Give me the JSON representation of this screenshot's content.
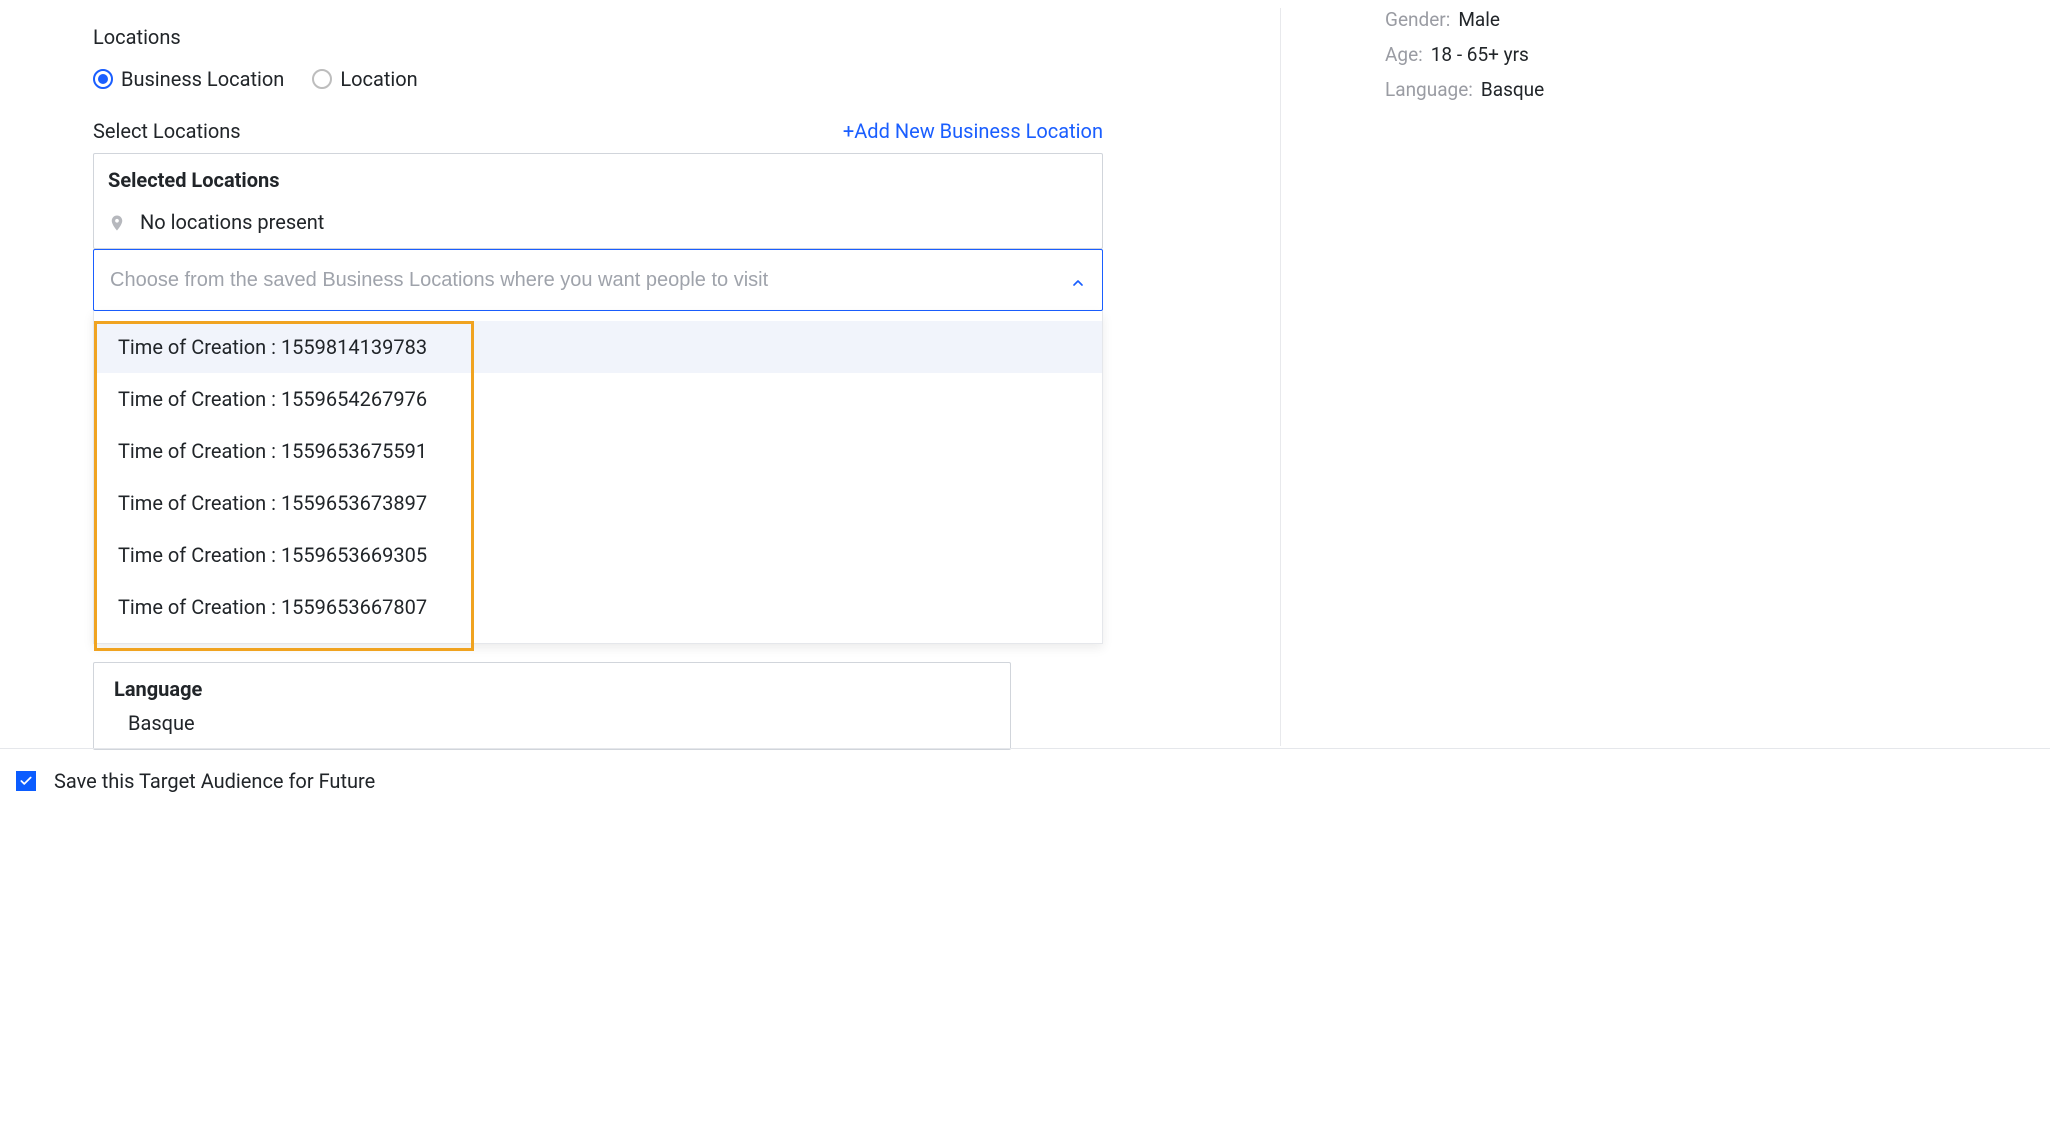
{
  "locations": {
    "section_label": "Locations",
    "radios": [
      {
        "label": "Business Location",
        "checked": true
      },
      {
        "label": "Location",
        "checked": false
      }
    ],
    "select_label": "Select Locations",
    "add_link": "+Add New Business Location",
    "selected_title": "Selected Locations",
    "no_locations": "No locations present",
    "search_placeholder": "Choose from the saved Business Locations where you want people to visit",
    "dropdown_items": [
      "Time of Creation : 1559814139783",
      "Time of Creation : 1559654267976",
      "Time of Creation : 1559653675591",
      "Time of Creation : 1559653673897",
      "Time of Creation : 1559653669305",
      "Time of Creation : 1559653667807"
    ]
  },
  "language": {
    "title": "Language",
    "value": "Basque"
  },
  "footer": {
    "save_label": "Save this Target Audience for Future",
    "checked": true
  },
  "sidebar": {
    "rows": [
      {
        "key": "Gender:",
        "value": "Male"
      },
      {
        "key": "Age:",
        "value": "18 - 65+ yrs"
      },
      {
        "key": "Language:",
        "value": "Basque"
      }
    ]
  }
}
